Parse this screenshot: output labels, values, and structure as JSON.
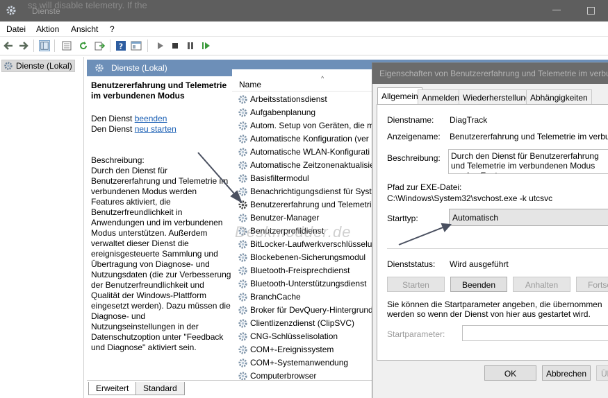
{
  "window": {
    "title": "Dienste",
    "bg_text": "ss will disable telemetry. If the"
  },
  "menu": [
    "Datei",
    "Aktion",
    "Ansicht",
    "?"
  ],
  "tree": {
    "root_label": "Dienste (Lokal)"
  },
  "pane": {
    "header": "Dienste (Lokal)"
  },
  "extended": {
    "title": "Benutzererfahrung und Telemetrie im verbundenen Modus",
    "stop_prefix": "Den Dienst ",
    "stop_link": "beenden",
    "restart_prefix": "Den Dienst ",
    "restart_link": "neu starten",
    "desc_label": "Beschreibung:",
    "desc_text": "Durch den Dienst für Benutzererfahrung und Telemetrie im verbundenen Modus werden Features aktiviert, die Benutzerfreundlichkeit in Anwendungen und im verbundenen Modus unterstützen. Außerdem verwaltet dieser Dienst die ereignisgesteuerte Sammlung und Übertragung von Diagnose- und Nutzungsdaten (die zur Verbesserung der Benutzerfreundlichkeit und Qualität der Windows-Plattform eingesetzt werden). Dazu müssen die Diagnose- und Nutzungseinstellungen in der Datenschutzoption unter \"Feedback und Diagnose\" aktiviert sein."
  },
  "list": {
    "column_name": "Name",
    "sort_indicator": "^",
    "rows": [
      "Arbeitsstationsdienst",
      "Aufgabenplanung",
      "Autom. Setup von Geräten, die m",
      "Automatische Konfiguration (ver",
      "Automatische WLAN-Konfigurati",
      "Automatische Zeitzonenaktualisie",
      "Basisfiltermodul",
      "Benachrichtigungsdienst für Syste",
      "Benutzererfahrung und Telemetri",
      "Benutzer-Manager",
      "Benutzerprofildienst",
      "BitLocker-Laufwerkverschlüsselun",
      "Blockebenen-Sicherungsmodul",
      "Bluetooth-Freisprechdienst",
      "Bluetooth-Unterstützungsdienst",
      "BranchCache",
      "Broker für DevQuery-Hintergrund",
      "Clientlizenzdienst (ClipSVC)",
      "CNG-Schlüsselisolation",
      "COM+-Ereignissystem",
      "COM+-Systemanwendung",
      "Computerbrowser"
    ],
    "selected_index": 8
  },
  "watermark": "Deskmodder.de",
  "bottom_tabs": [
    "Erweitert",
    "Standard"
  ],
  "dialog": {
    "title": "Eigenschaften von Benutzererfahrung und Telemetrie im verbun",
    "tabs": [
      "Allgemein",
      "Anmelden",
      "Wiederherstellung",
      "Abhängigkeiten"
    ],
    "active_tab": "Allgemein",
    "service_name_label": "Dienstname:",
    "service_name": "DiagTrack",
    "display_name_label": "Anzeigename:",
    "display_name": "Benutzererfahrung und Telemetrie im verbunde",
    "description_label": "Beschreibung:",
    "description": "Durch den Dienst für Benutzererfahrung und Telemetrie im verbundenen Modus werden Featu",
    "exe_path_label": "Pfad zur EXE-Datei:",
    "exe_path": "C:\\Windows\\System32\\svchost.exe -k utcsvc",
    "start_type_label": "Starttyp:",
    "start_type": "Automatisch",
    "status_label": "Dienststatus:",
    "status": "Wird ausgeführt",
    "btn_start": "Starten",
    "btn_stop": "Beenden",
    "btn_pause": "Anhalten",
    "btn_resume": "Fortse",
    "params_note": "Sie können die Startparameter angeben, die übernommen werden so wenn der Dienst von hier aus gestartet wird.",
    "params_label": "Startparameter:",
    "btn_ok": "OK",
    "btn_cancel": "Abbrechen",
    "btn_apply": "Üb"
  },
  "colors": {
    "title_bar": "#5e5e5e",
    "pane_header": "#6d8fb8",
    "link": "#1a5fb4",
    "arrow": "#4a5060"
  }
}
